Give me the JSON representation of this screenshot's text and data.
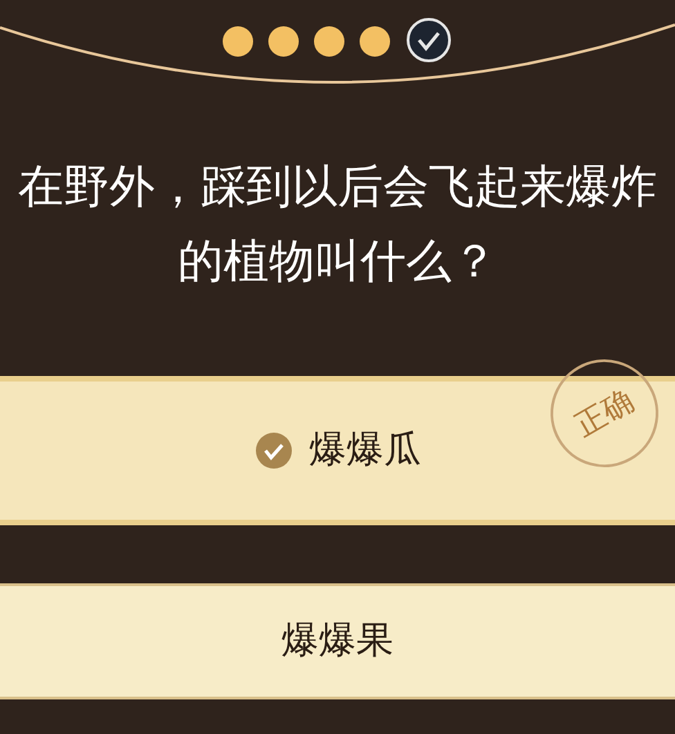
{
  "progress": [
    {
      "kind": "dot"
    },
    {
      "kind": "dot"
    },
    {
      "kind": "dot"
    },
    {
      "kind": "dot"
    },
    {
      "kind": "check"
    }
  ],
  "question": "在野外，踩到以后会飞起来爆炸的植物叫什么？",
  "options": [
    {
      "text": "爆爆瓜",
      "selected": true,
      "stamp": "正确"
    },
    {
      "text": "爆爆果",
      "selected": false
    }
  ]
}
